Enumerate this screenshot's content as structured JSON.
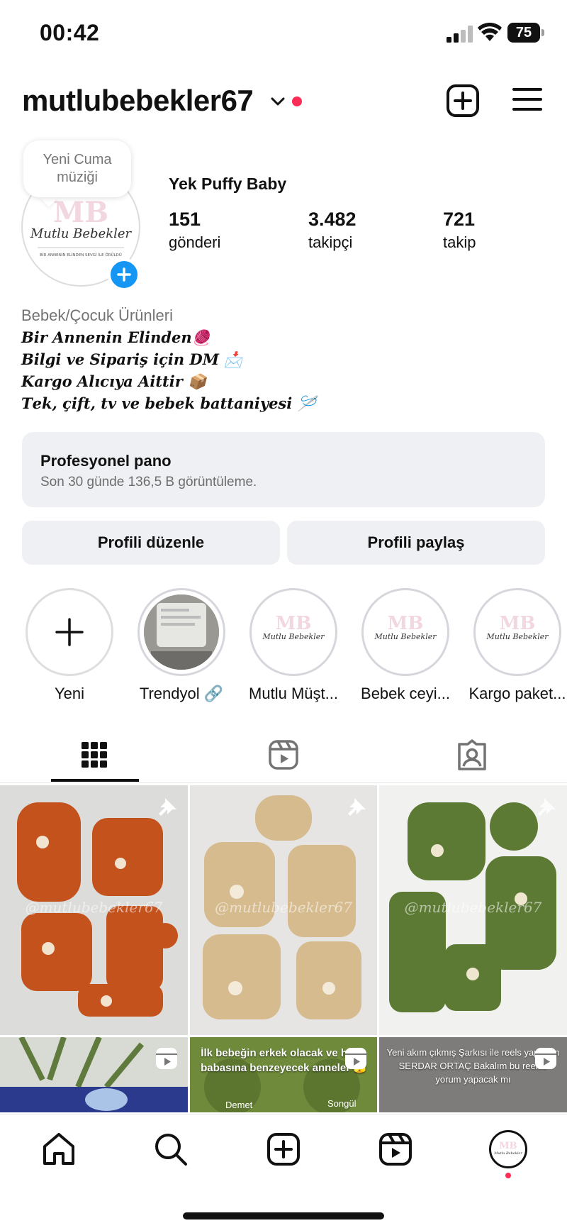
{
  "status_bar": {
    "time": "00:42",
    "battery": "75"
  },
  "header": {
    "username": "mutlubebekler67"
  },
  "profile": {
    "note": "Yeni Cuma müziği",
    "display_name": "Yek Puffy Baby",
    "stats": [
      {
        "value": "151",
        "label": "gönderi"
      },
      {
        "value": "3.482",
        "label": "takipçi"
      },
      {
        "value": "721",
        "label": "takip"
      }
    ],
    "avatar_text": "Mutlu Bebekler",
    "avatar_tagline": "BİR ANNENİN ELİNDEN SEVGİ İLE ÖRÜLDÜ"
  },
  "bio": {
    "category": "Bebek/Çocuk Ürünleri",
    "lines": [
      "𝑩𝒊𝒓 𝑨𝒏𝒏𝒆𝒏𝒊𝒏 𝑬𝒍𝒊𝒏𝒅𝒆𝒏🧶",
      "𝑩𝒊𝒍𝒈𝒊 𝒗𝒆 𝑺𝒊𝒑𝒂𝒓𝒊ş 𝒊ç𝒊𝒏 𝑫𝑴 📩",
      "𝑲𝒂𝒓𝒈𝒐 𝑨𝒍ı𝒄ı𝒚𝒂 𝑨𝒊𝒕𝒕𝒊𝒓 📦",
      "𝑻𝒆𝒌, ç𝒊𝒇𝒕, 𝒕𝒗 𝒗𝒆 𝒃𝒆𝒃𝒆𝒌 𝒃𝒂𝒕𝒕𝒂𝒏𝒊𝒚𝒆𝒔𝒊 🪡"
    ]
  },
  "pro_dashboard": {
    "title": "Profesyonel pano",
    "subtitle": "Son 30 günde 136,5 B görüntüleme."
  },
  "buttons": {
    "edit": "Profili düzenle",
    "share": "Profili paylaş"
  },
  "highlights": [
    {
      "label": "Yeni"
    },
    {
      "label": "Trendyol 🔗"
    },
    {
      "label": "Mutlu Müşt..."
    },
    {
      "label": "Bebek ceyi..."
    },
    {
      "label": "Kargo paket..."
    }
  ],
  "posts": [
    {
      "type": "pinned",
      "watermark": "@mutlubebekler67",
      "color": "#c4521d"
    },
    {
      "type": "pinned",
      "watermark": "@mutlubebekler67",
      "color": "#d6bb8f"
    },
    {
      "type": "pinned",
      "watermark": "@mutlubebekler67",
      "color": "#5d7a35"
    },
    {
      "type": "reel",
      "caption": "",
      "color": "#2b3a8c"
    },
    {
      "type": "reel",
      "caption": "İlk bebeğin erkek olacak ve huyu babasına benzeyecek anneler 🫣",
      "tag_left": "Demet",
      "tag_right": "Songül",
      "color": "#6e8a3a"
    },
    {
      "type": "reel",
      "caption": "Yeni akım çıkmış Şarkısı ile reels yaptığım SERDAR ORTAÇ Bakalım bu reelse yorum yapacak mı",
      "color": "#8f8f8f"
    }
  ],
  "colors": {
    "accent_blue": "#1596f5",
    "notification_red": "#ff2d55",
    "button_bg": "#eff0f3"
  }
}
